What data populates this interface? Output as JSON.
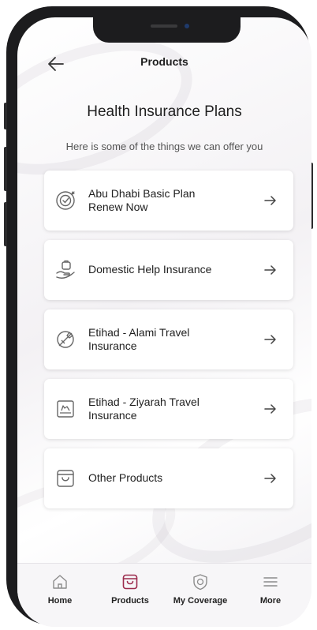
{
  "header": {
    "title": "Products"
  },
  "main": {
    "heading": "Health Insurance Plans",
    "subheading": "Here is some of the things we can offer you",
    "products": [
      {
        "line1": "Abu Dhabi Basic Plan",
        "line2": "Renew Now",
        "icon": "target-check-icon"
      },
      {
        "line1": "Domestic Help Insurance",
        "line2": "",
        "icon": "hand-bag-icon"
      },
      {
        "line1": "Etihad - Alami Travel",
        "line2": "Insurance",
        "icon": "plane-globe-icon"
      },
      {
        "line1": "Etihad - Ziyarah Travel",
        "line2": "Insurance",
        "icon": "travel-document-icon"
      },
      {
        "line1": "Other Products",
        "line2": "",
        "icon": "shopping-bag-icon"
      }
    ]
  },
  "tabs": [
    {
      "label": "Home",
      "icon": "home-icon",
      "active": false
    },
    {
      "label": "Products",
      "icon": "bag-icon",
      "active": true
    },
    {
      "label": "My Coverage",
      "icon": "shield-icon",
      "active": false
    },
    {
      "label": "More",
      "icon": "menu-icon",
      "active": false
    }
  ],
  "colors": {
    "accent": "#9c2b4d",
    "text": "#1f1f1f",
    "muted": "#8c8c8c"
  }
}
